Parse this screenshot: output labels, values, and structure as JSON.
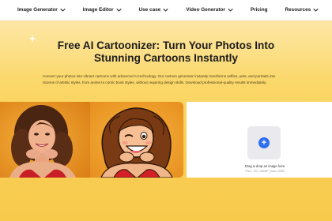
{
  "nav": {
    "items": [
      {
        "label": "Image Generator",
        "has_dropdown": true
      },
      {
        "label": "Image Editor",
        "has_dropdown": true
      },
      {
        "label": "Use case",
        "has_dropdown": true
      },
      {
        "label": "Video Generator",
        "has_dropdown": true
      },
      {
        "label": "Pricing",
        "has_dropdown": false
      },
      {
        "label": "Resources",
        "has_dropdown": true
      }
    ]
  },
  "hero": {
    "title_line1": "Free AI Cartoonizer: Turn Your Photos Into",
    "title_line2": "Stunning Cartoons Instantly",
    "description": "Convert your photos into vibrant cartoons with advanced AI technology. Our cartoon generator instantly transforms selfies, pets, and portraits into dozens of artistic styles, from anime to comic book styles, without requiring design skills. Download professional-quality results immediately."
  },
  "upload": {
    "icon": "plus-icon",
    "label": "Drag & drop an image here",
    "formats": "PNG, JPG, WEBP | Max 10MB"
  },
  "colors": {
    "hero_bg": "#f9cf56",
    "accent_blue": "#2f6ef0",
    "photo_bg": "#e8901e"
  }
}
